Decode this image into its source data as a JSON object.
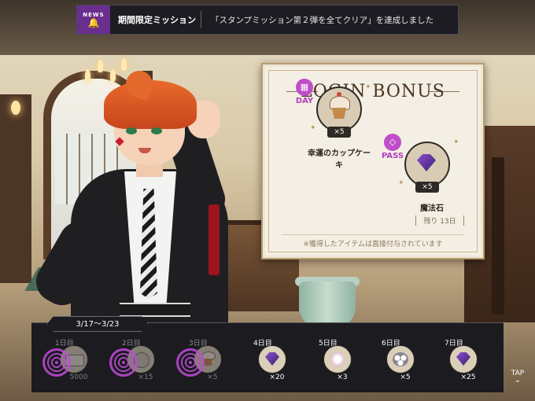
{
  "banner": {
    "badge": "NEWS",
    "label": "期間限定ミッション",
    "message": "「スタンプミッション第２弾を全てクリア」を達成しました"
  },
  "login_bonus": {
    "title": "LOGIN BONUS",
    "day_reward": {
      "tag": "DAY",
      "count": "×5",
      "name_line1": "幸運のカップケー",
      "name_line2": "キ"
    },
    "pass_reward": {
      "tag": "PASS",
      "count": "×5",
      "name": "魔法石",
      "remaining": "残り 13日"
    },
    "note": "※獲得したアイテムは直接付与されています"
  },
  "calendar": {
    "date_range": "3/17〜3/23",
    "days": [
      {
        "label": "1日目",
        "count": "5000",
        "claimed": true,
        "icon": "ticket-icon"
      },
      {
        "label": "2日目",
        "count": "×15",
        "claimed": true,
        "icon": "coin-icon"
      },
      {
        "label": "3日目",
        "count": "×5",
        "claimed": true,
        "icon": "cupcake-icon"
      },
      {
        "label": "4日目",
        "count": "×20",
        "claimed": false,
        "icon": "gem-icon"
      },
      {
        "label": "5日目",
        "count": "×3",
        "claimed": false,
        "icon": "flower-icon"
      },
      {
        "label": "6日目",
        "count": "×5",
        "claimed": false,
        "icon": "orbs-icon"
      },
      {
        "label": "7日目",
        "count": "×25",
        "claimed": false,
        "icon": "gem-icon"
      }
    ]
  },
  "tap_label": "TAP",
  "colors": {
    "accent": "#bf4ec8",
    "panel_bg": "#f4efe4",
    "dark_bar": "#1b1b20"
  }
}
